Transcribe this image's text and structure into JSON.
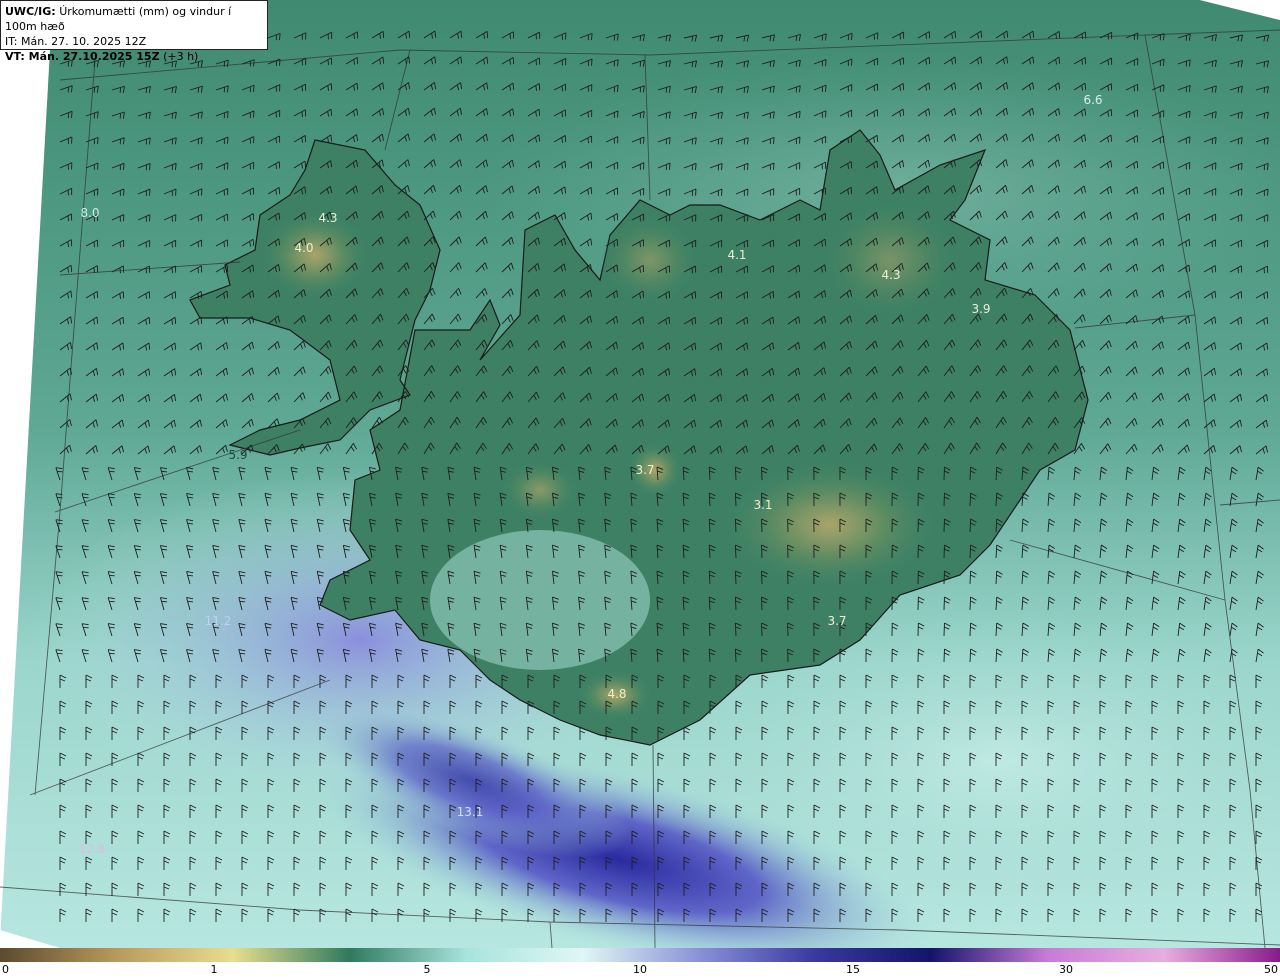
{
  "title": {
    "model": "UWC/IG:",
    "field": "Úrkomumætti (mm) og vindur í 100m hæð",
    "init": "IT: Mán. 27. 10. 2025 12Z",
    "valid_bold": "VT: Mán. 27.10.2025 15Z",
    "valid_lead": "(+3 h)"
  },
  "colorbar": {
    "labels": [
      "0",
      "1",
      "5",
      "10",
      "15",
      "30",
      "50"
    ],
    "colors": [
      "#5b4a2e",
      "#b89a5c",
      "#e9dd8e",
      "#2f7a5e",
      "#a8e3dd",
      "#dff7f5",
      "#8c92d8",
      "#3a3aa0",
      "#14146a",
      "#c77bd6",
      "#e7aee0",
      "#8a1a8a"
    ]
  },
  "value_labels": [
    {
      "text": "6.6",
      "color": "#d6efe9"
    },
    {
      "text": "8.0",
      "color": "#cfeae3"
    },
    {
      "text": "4.3",
      "color": "#e8efd2"
    },
    {
      "text": "4.0",
      "color": "#f2efc8"
    },
    {
      "text": "4.1",
      "color": "#eaf0cf"
    },
    {
      "text": "4.3",
      "color": "#eaf0cf"
    },
    {
      "text": "3.9",
      "color": "#eaf0cf"
    },
    {
      "text": "5.9",
      "color": "#1d4b3c"
    },
    {
      "text": "3.7",
      "color": "#f2efc8"
    },
    {
      "text": "3.1",
      "color": "#f2efc8"
    },
    {
      "text": "3.7",
      "color": "#f2efc8"
    },
    {
      "text": "11.2",
      "color": "#c6cdf0"
    },
    {
      "text": "4.8",
      "color": "#f2efc8"
    },
    {
      "text": "13.1",
      "color": "#d5dbf6"
    },
    {
      "text": "12.8",
      "color": "#e3b8e6"
    }
  ]
}
